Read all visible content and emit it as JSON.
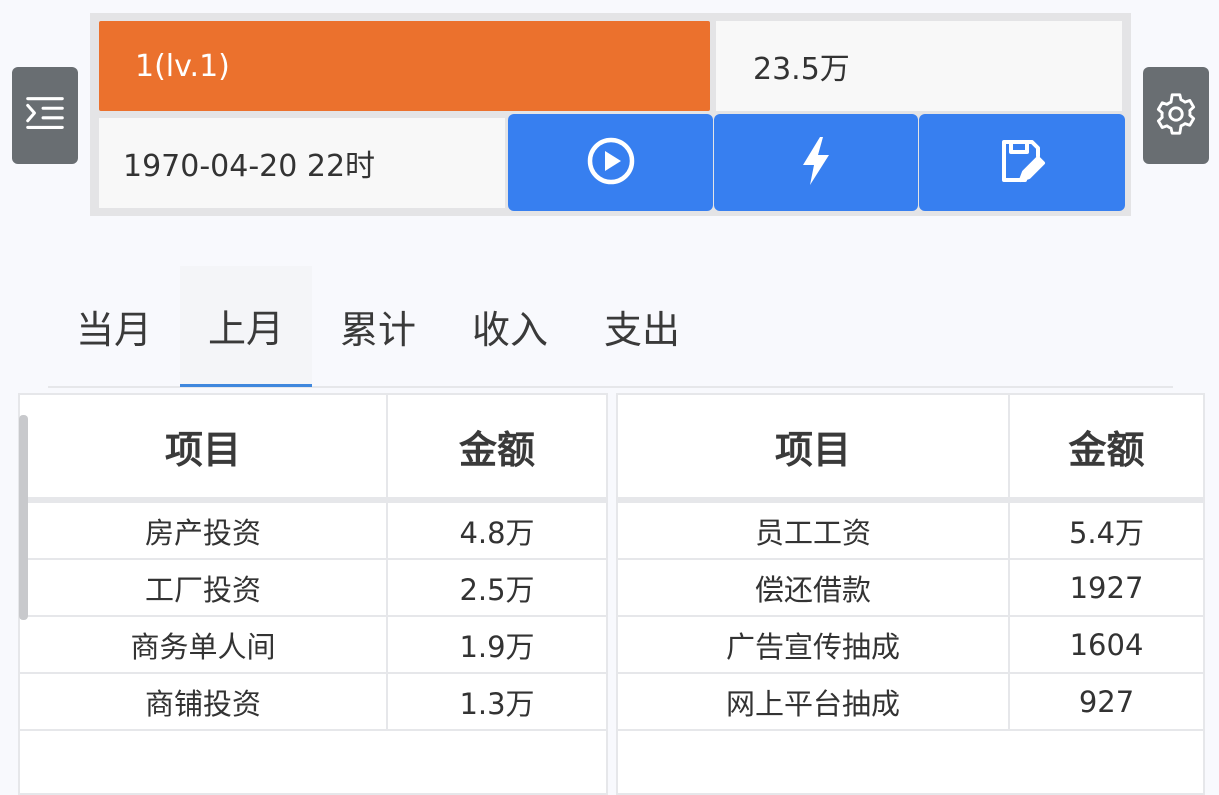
{
  "header": {
    "level_text": "1(lv.1)",
    "money_text": "23.5万",
    "datetime_text": "1970-04-20 22时",
    "colors": {
      "level_bar": "#eb712d",
      "action_button": "#377ff0",
      "side_button": "#696e72"
    },
    "icons": {
      "menu": "indent-menu-icon",
      "settings": "gear-icon",
      "play": "play-circle-icon",
      "boost": "lightning-icon",
      "save": "save-edit-icon"
    }
  },
  "tabs": [
    {
      "label": "当月",
      "active": false
    },
    {
      "label": "上月",
      "active": true
    },
    {
      "label": "累计",
      "active": false
    },
    {
      "label": "收入",
      "active": false
    },
    {
      "label": "支出",
      "active": false
    }
  ],
  "income_table": {
    "headers": [
      "项目",
      "金额"
    ],
    "rows": [
      [
        "房产投资",
        "4.8万"
      ],
      [
        "工厂投资",
        "2.5万"
      ],
      [
        "商务单人间",
        "1.9万"
      ],
      [
        "商铺投资",
        "1.3万"
      ]
    ]
  },
  "expense_table": {
    "headers": [
      "项目",
      "金额"
    ],
    "rows": [
      [
        "员工工资",
        "5.4万"
      ],
      [
        "偿还借款",
        "1927"
      ],
      [
        "广告宣传抽成",
        "1604"
      ],
      [
        "网上平台抽成",
        "927"
      ]
    ]
  }
}
